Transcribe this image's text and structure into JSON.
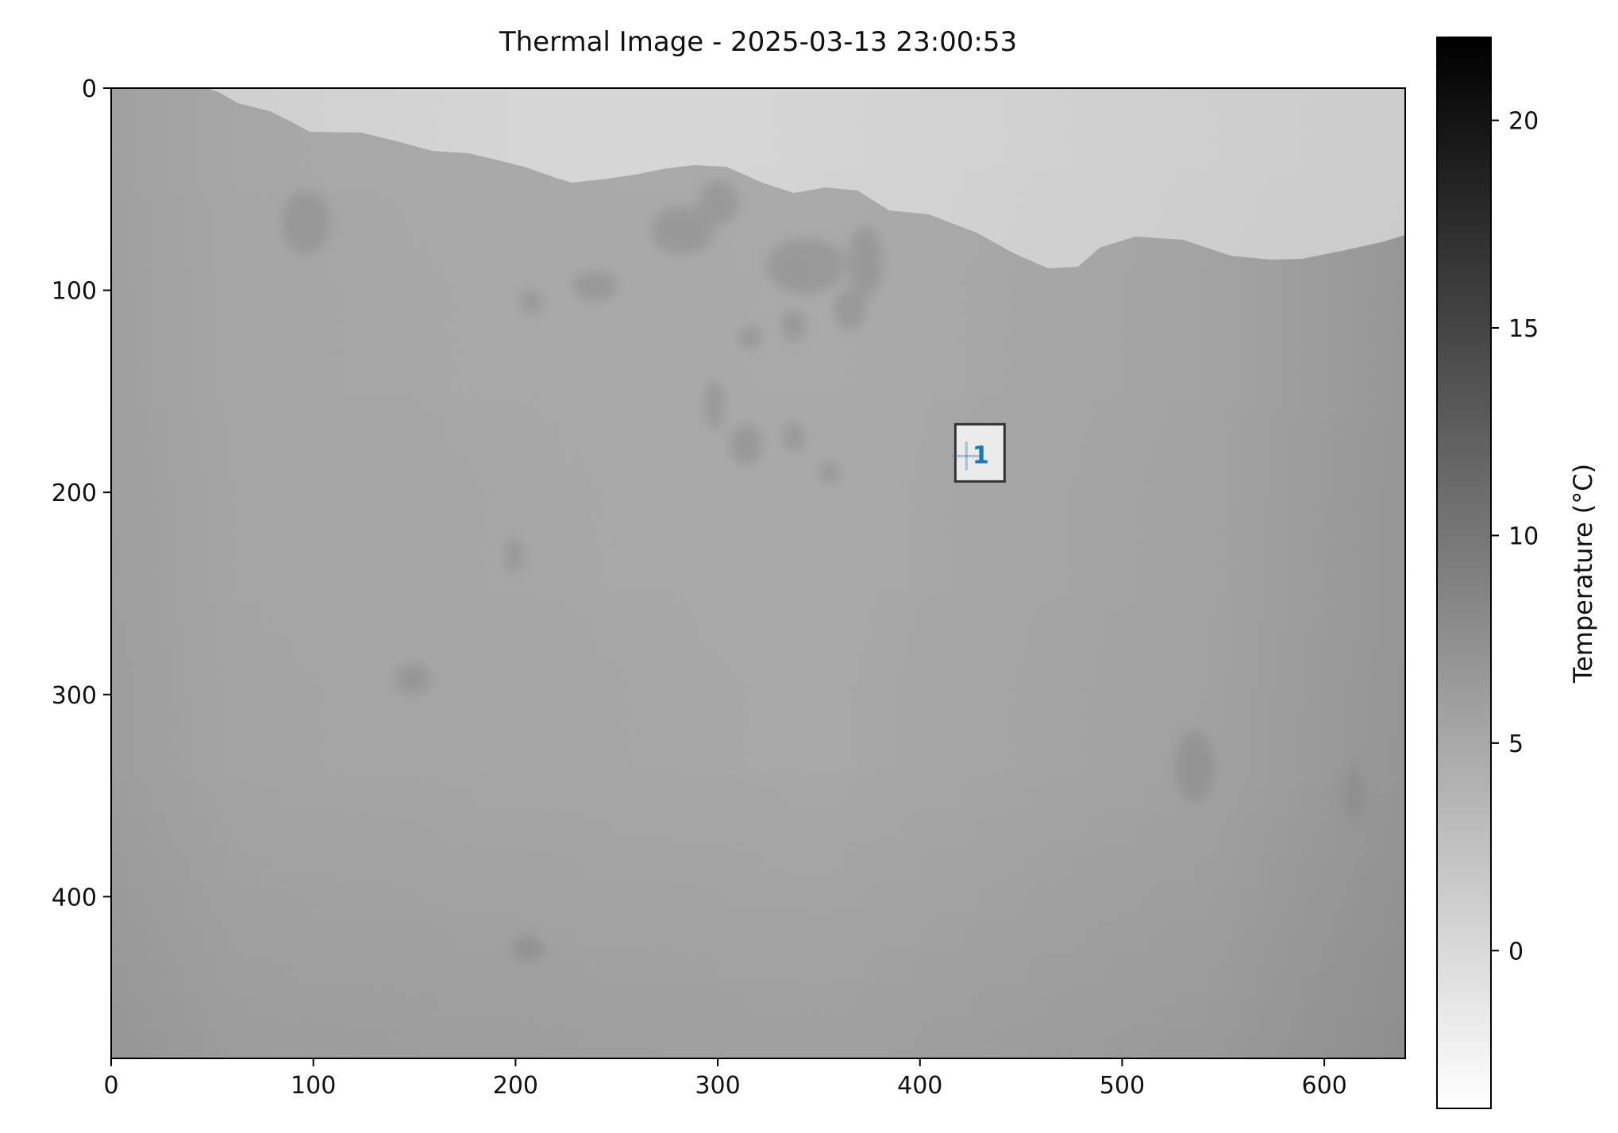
{
  "chart_data": {
    "type": "heatmap",
    "title": "Thermal Image - 2025-03-13 23:00:53",
    "xlim": [
      0,
      640
    ],
    "ylim": [
      480,
      0
    ],
    "x_ticks": [
      0,
      100,
      200,
      300,
      400,
      500,
      600
    ],
    "y_ticks": [
      0,
      100,
      200,
      300,
      400
    ],
    "colormap": "gray_r",
    "colorbar": {
      "label": "Temperature (°C)",
      "range": [
        -3.8,
        22
      ],
      "ticks": [
        0,
        5,
        10,
        15,
        20
      ]
    },
    "markers": [
      {
        "label": "1",
        "x": 423,
        "y": 182,
        "color": "#1f77b4"
      }
    ]
  }
}
